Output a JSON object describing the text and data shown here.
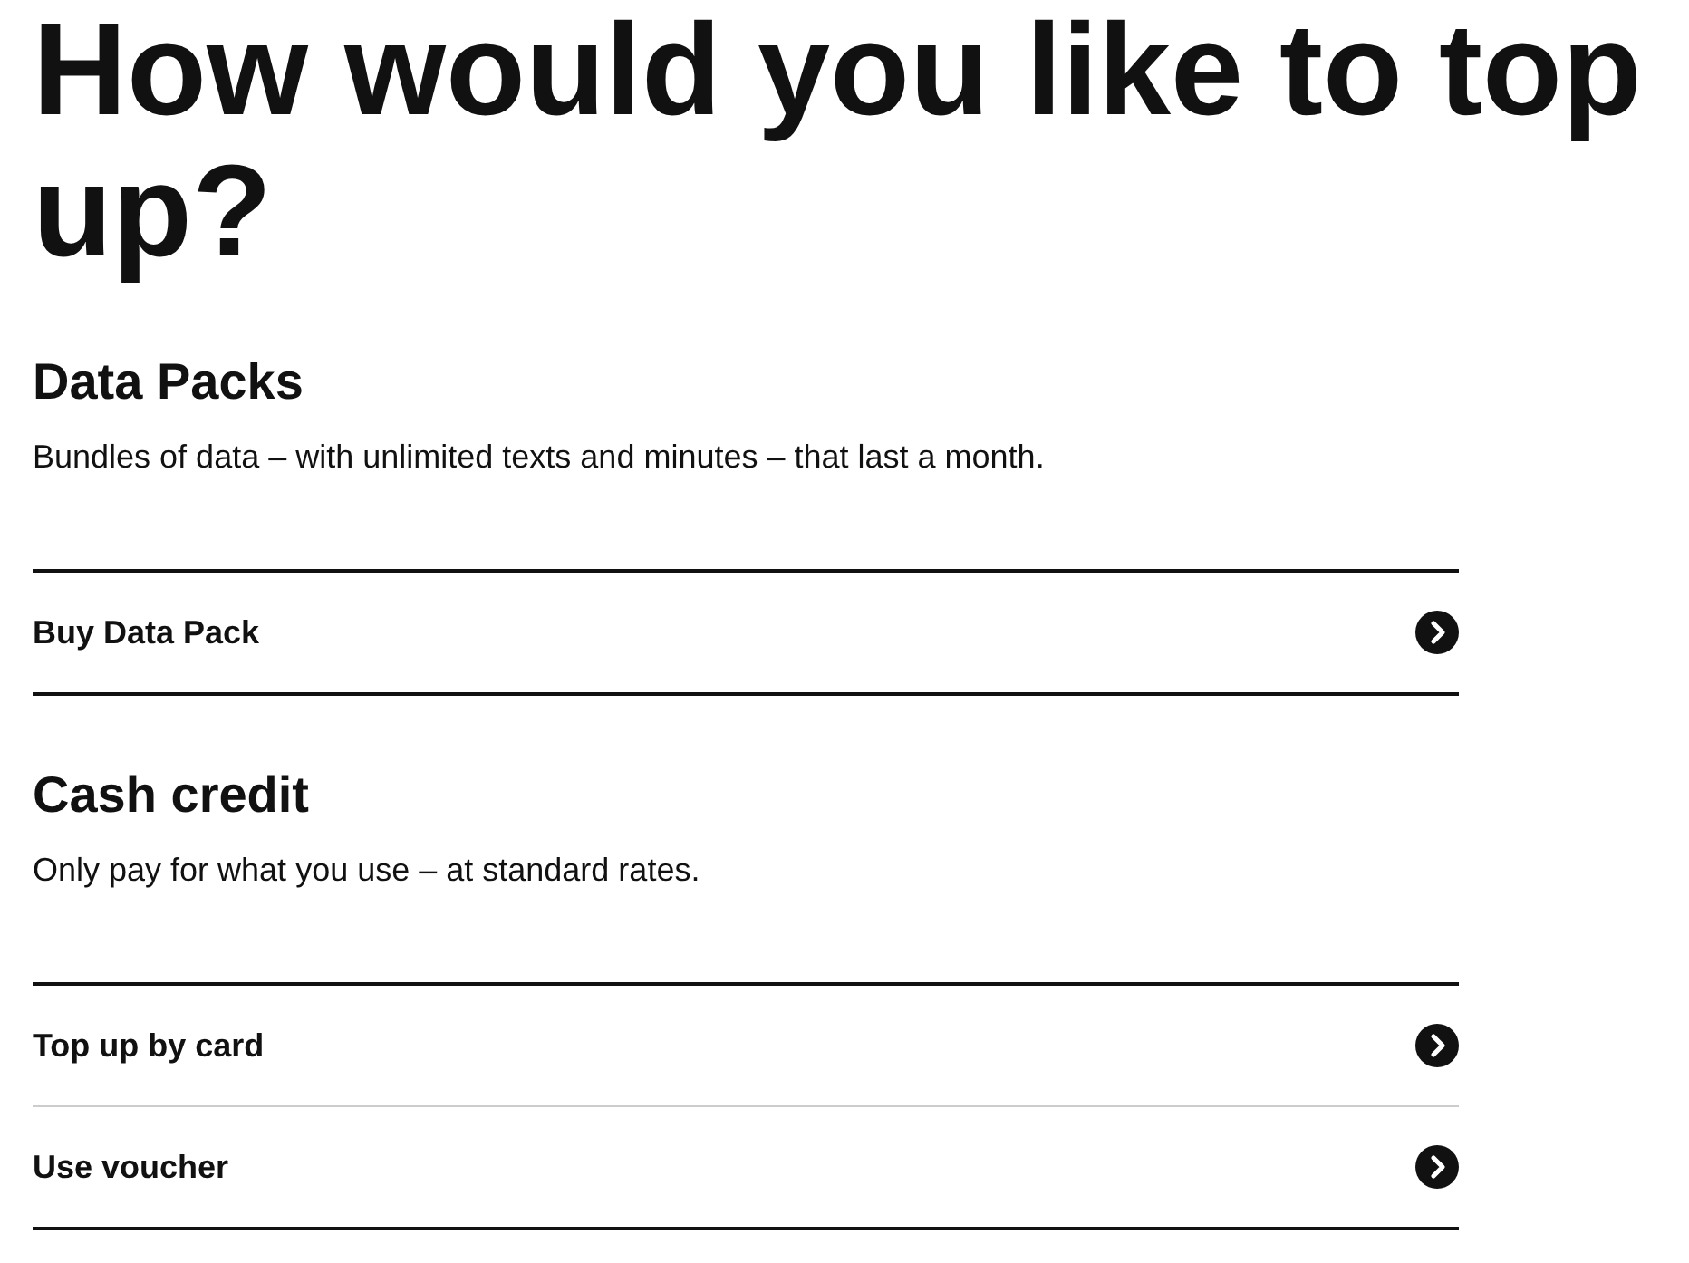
{
  "heading": "How would you like to top up?",
  "sections": [
    {
      "title": "Data Packs",
      "description": "Bundles of data – with unlimited texts and minutes – that last a month.",
      "options": [
        {
          "label": "Buy Data Pack"
        }
      ]
    },
    {
      "title": "Cash credit",
      "description": "Only pay for what you use – at standard rates.",
      "options": [
        {
          "label": "Top up by card"
        },
        {
          "label": "Use voucher"
        }
      ]
    }
  ]
}
